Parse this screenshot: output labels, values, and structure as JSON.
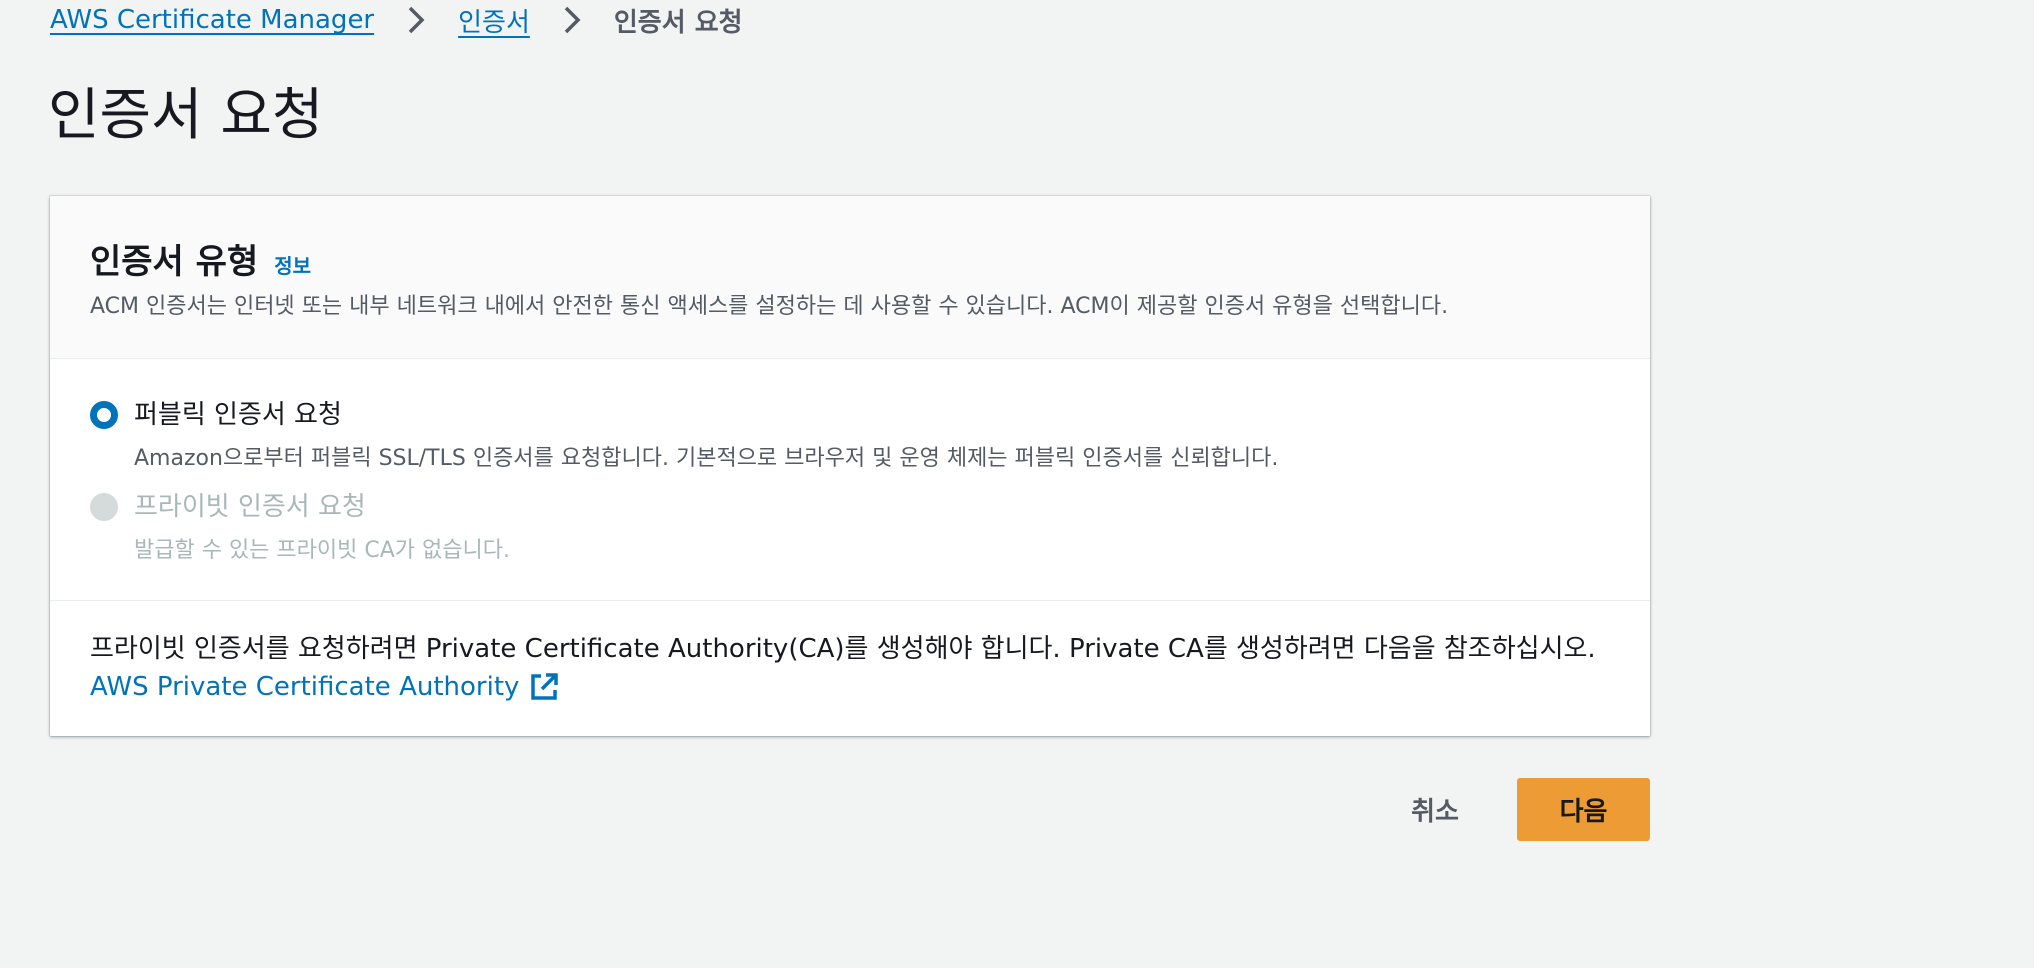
{
  "breadcrumb": {
    "items": [
      {
        "label": "AWS Certificate Manager"
      },
      {
        "label": "인증서"
      }
    ],
    "current": "인증서 요청"
  },
  "page": {
    "title": "인증서 요청"
  },
  "card": {
    "title": "인증서 유형",
    "info_label": "정보",
    "description": "ACM 인증서는 인터넷 또는 내부 네트워크 내에서 안전한 통신 액세스를 설정하는 데 사용할 수 있습니다. ACM이 제공할 인증서 유형을 선택합니다.",
    "options": [
      {
        "label": "퍼블릭 인증서 요청",
        "description": "Amazon으로부터 퍼블릭 SSL/TLS 인증서를 요청합니다. 기본적으로 브라우저 및 운영 체제는 퍼블릭 인증서를 신뢰합니다.",
        "selected": true,
        "disabled": false
      },
      {
        "label": "프라이빗 인증서 요청",
        "description": "발급할 수 있는 프라이빗 CA가 없습니다.",
        "selected": false,
        "disabled": true
      }
    ],
    "note": "프라이빗 인증서를 요청하려면 Private Certificate Authority(CA)를 생성해야 합니다. Private CA를 생성하려면 다음을 참조하십시오.",
    "note_link": "AWS Private Certificate Authority"
  },
  "actions": {
    "cancel_label": "취소",
    "next_label": "다음"
  },
  "colors": {
    "link": "#0073bb",
    "primary_button": "#ec9b35",
    "background": "#f2f3f3"
  },
  "icons": {
    "breadcrumb_separator": "chevron-right-icon",
    "external_link": "external-link-icon"
  }
}
